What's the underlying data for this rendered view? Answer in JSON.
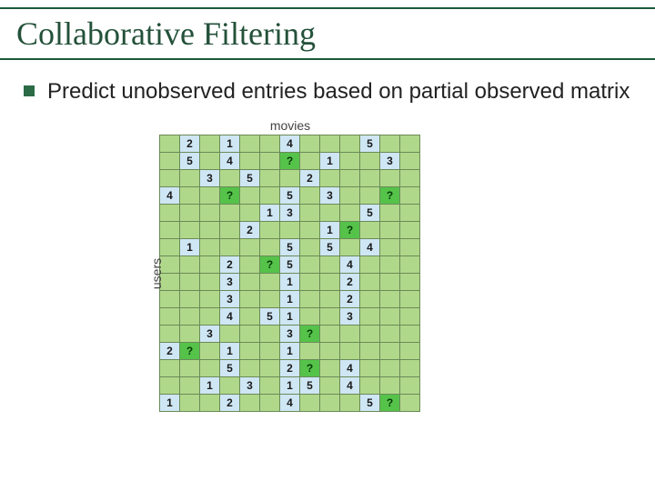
{
  "title": "Collaborative Filtering",
  "bullet": {
    "text": "Predict unobserved entries based on partial observed matrix"
  },
  "figure": {
    "x_label": "movies",
    "y_label": "users",
    "rows": 15,
    "cols": 13,
    "matrix": [
      [
        null,
        "2",
        null,
        "1",
        null,
        null,
        "4",
        null,
        null,
        null,
        "5",
        null,
        null
      ],
      [
        null,
        "5",
        null,
        "4",
        null,
        null,
        "?",
        null,
        "1",
        null,
        null,
        "3",
        null
      ],
      [
        null,
        null,
        "3",
        null,
        "5",
        null,
        null,
        "2",
        null,
        null,
        null,
        null,
        null
      ],
      [
        "4",
        null,
        null,
        "?",
        null,
        null,
        "5",
        null,
        "3",
        null,
        null,
        "?",
        null
      ],
      [
        null,
        null,
        null,
        null,
        null,
        "1",
        "3",
        null,
        null,
        null,
        "5",
        null,
        null
      ],
      [
        null,
        null,
        null,
        null,
        "2",
        null,
        null,
        null,
        "1",
        "?",
        null,
        null,
        null
      ],
      [
        null,
        "1",
        null,
        null,
        null,
        null,
        "5",
        null,
        "5",
        null,
        "4",
        null,
        null
      ],
      [
        null,
        null,
        null,
        "2",
        null,
        "?",
        "5",
        null,
        null,
        "4",
        null,
        null,
        null
      ],
      [
        null,
        null,
        null,
        "3",
        null,
        null,
        "1",
        null,
        null,
        "2",
        null,
        null,
        null
      ],
      [
        null,
        null,
        null,
        "3",
        null,
        null,
        "1",
        null,
        null,
        "2",
        null,
        null,
        null
      ],
      [
        null,
        null,
        null,
        "4",
        null,
        "5",
        "1",
        null,
        null,
        "3",
        null,
        null,
        null
      ],
      [
        null,
        null,
        "3",
        null,
        null,
        null,
        "3",
        "?",
        null,
        null,
        null,
        null,
        null
      ],
      [
        "2",
        "?",
        null,
        "1",
        null,
        null,
        "1",
        null,
        null,
        null,
        null,
        null,
        null
      ],
      [
        null,
        null,
        null,
        "5",
        null,
        null,
        "2",
        "?",
        null,
        "4",
        null,
        null,
        null
      ],
      [
        null,
        null,
        "1",
        null,
        "3",
        null,
        "1",
        "5",
        null,
        "4",
        null,
        null,
        null
      ],
      [
        "1",
        null,
        null,
        "2",
        null,
        null,
        "4",
        null,
        null,
        null,
        "5",
        "?",
        null
      ]
    ]
  }
}
